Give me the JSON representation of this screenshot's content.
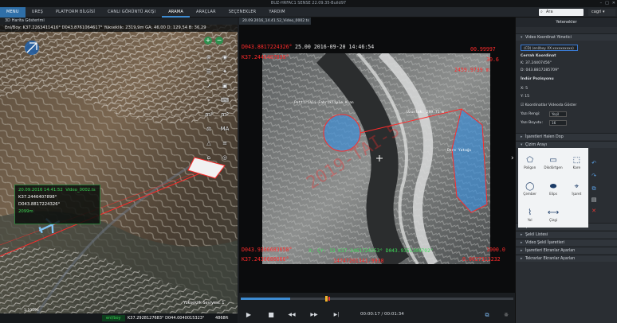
{
  "window": {
    "title": "BUZ-HRFAC1 SENSE 22.09.35-Build97"
  },
  "menu": {
    "items": [
      {
        "label": "MENU",
        "state": "active"
      },
      {
        "label": "UREŞ",
        "state": ""
      },
      {
        "label": "PLATFORM BİLGİSİ",
        "state": ""
      },
      {
        "label": "CANLI GÖRÜNTÜ AKIŞI",
        "state": ""
      },
      {
        "label": "ARAMA",
        "state": "sel"
      },
      {
        "label": "ARAÇLAR",
        "state": ""
      },
      {
        "label": "SEÇENEKLER",
        "state": ""
      },
      {
        "label": "YARDIM",
        "state": ""
      }
    ],
    "search_placeholder": "Ara",
    "user": "cagri"
  },
  "map": {
    "header": "3D Harita Gösterimi",
    "coords_bar": "Enl/Boy: K37.2263411416°  D043.8761064617°  Yükseklik: 2319,9m  GA: 46,00  D: 129,54  B: 36,29",
    "popup": {
      "time": "20.09.2016 14:41:52",
      "name": "Video_0002.ts",
      "lat": "K37.2446407898°",
      "lon": "D043.8817224326°",
      "alt": "2099m"
    },
    "altitude_level": "Yükseklik Seviyesi: 1",
    "scale": "1:10196",
    "bottom": {
      "tag": "enl/boy",
      "coord": "K37.2928127683° D044.0040015323°",
      "alt": "4868ft"
    },
    "tools": [
      "⊗",
      "◉",
      "☰",
      "✦",
      "↗",
      "▣",
      "⌖",
      "⌨",
      "m²",
      "m³",
      "⚖",
      "MA",
      "△",
      "≡",
      "⌂",
      "◎"
    ]
  },
  "video": {
    "tab": "20.09.2016_14.41.52_Video_0002.ts",
    "overlay": {
      "tl1": "D043.8817224326°",
      "tl2": "K37.2446407898°",
      "top_center": "25.00  2016-09-20  14:46:54",
      "tr1": "00.99997",
      "tr2": "30.6",
      "tr3": "2459.9739 m",
      "bl1": "D043.9386683658°",
      "bl2": "K37.2436686666°",
      "bottom_center": "X: ÇY: 13 K37.2461724353° D043.9351309702°",
      "bottom_center2": "14747201341.9938",
      "br1": "1000.0",
      "br2": "0.0027313232",
      "tag1": "Pettirinli Fabrikliyle Alan",
      "tag2": "Uzunluk: 299.71 m",
      "tag3": "Dere Yatağı",
      "watermark": "2019-TAI-5"
    },
    "time": "00:00:17 / 00:01:34",
    "progress": 0.18,
    "controls": [
      "▶",
      "■",
      "◀◀",
      "▶▶",
      "▶|"
    ],
    "right_controls": [
      "⧉",
      "☼",
      "◐",
      "⊕",
      "⊖",
      "⛶"
    ]
  },
  "panel": {
    "title": "Yetenekler",
    "sec1": "Video Koordinat Yönetici",
    "datum": "(CD) (enl/boy XX.xxxxxxxxxx)",
    "center_label": "Cerrah Koordinat",
    "center_lat": "K: 37.24407456°",
    "center_lon": "D: 043.8817285709°",
    "pos_label": "İndür Pozisyonu",
    "x_label": "X: 5",
    "y_label": "Y: 15",
    "show_coords": "Koordinatlar Videoda Göster",
    "font_color_label": "Yazı Rengi:",
    "font_color": "Yeşil",
    "font_size_label": "Yazı Boyutu:",
    "font_size": "16",
    "sec_ishare": "İşaretleri Halen Dop",
    "sec_cizim": "Çizim Arayı",
    "tools": [
      {
        "glyph": "⬠",
        "label": "Poligon"
      },
      {
        "glyph": "▭",
        "label": "Dikdörtgen"
      },
      {
        "glyph": "⬚",
        "label": "Kare"
      },
      {
        "glyph": "◯",
        "label": "Çember"
      },
      {
        "glyph": "⬬",
        "label": "Elips"
      },
      {
        "glyph": "⌖",
        "label": "İşaret"
      },
      {
        "glyph": "⌇",
        "label": "Yol"
      },
      {
        "glyph": "⟷",
        "label": "Çizgi"
      }
    ],
    "bottom_sections": [
      "Şekil Özellikleri",
      "Şekil Listesi",
      "Video Şekil İşaretleri",
      "İşaretleri Ekranlar Ayarları",
      "Tekrarlar Ekranlar Ayarları"
    ]
  }
}
